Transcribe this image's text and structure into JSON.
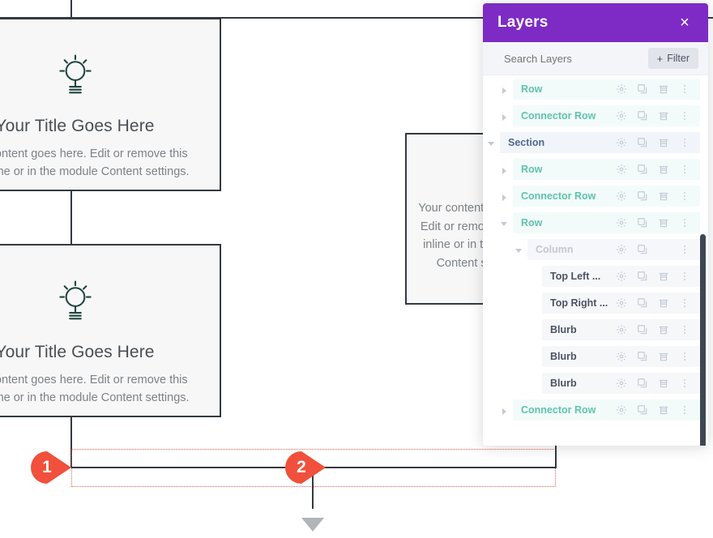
{
  "canvas": {
    "cards": [
      {
        "icon": "lightbulb-icon",
        "title": "Your Title Goes Here",
        "body": "Your content goes here. Edit or remove this text inline or in the module Content settings."
      },
      {
        "icon": "lightbulb-icon",
        "title": "Your Title Goes Here",
        "body": "Your content goes here. Edit or remove this text inline or in the module Content settings."
      }
    ],
    "content_box": {
      "text": "Your content goes here. Edit or remove this text inline or in the module Content settings."
    },
    "markers": [
      {
        "number": "1"
      },
      {
        "number": "2"
      }
    ],
    "selection_color": "#e8614d",
    "line_color": "#333a3f",
    "arrow_color": "#b0b5ba"
  },
  "layers_panel": {
    "title": "Layers",
    "close_label": "×",
    "accent": "#7d2bc4",
    "search": {
      "placeholder": "Search Layers",
      "value": ""
    },
    "filter": {
      "plus": "+",
      "label": "Filter"
    },
    "icons": {
      "settings": "gear-icon",
      "duplicate": "duplicate-icon",
      "delete": "trash-icon",
      "more": "more-vertical-icon"
    },
    "rows": [
      {
        "label": "Row",
        "type": "row",
        "indent": 1,
        "caret": "closed",
        "actions": [
          "settings",
          "duplicate",
          "delete",
          "more"
        ]
      },
      {
        "label": "Connector Row",
        "type": "row",
        "indent": 1,
        "caret": "closed",
        "actions": [
          "settings",
          "duplicate",
          "delete",
          "more"
        ]
      },
      {
        "label": "Section",
        "type": "section",
        "indent": 0,
        "caret": "open",
        "actions": [
          "settings",
          "duplicate",
          "delete",
          "more"
        ]
      },
      {
        "label": "Row",
        "type": "row",
        "indent": 1,
        "caret": "closed",
        "actions": [
          "settings",
          "duplicate",
          "delete",
          "more"
        ]
      },
      {
        "label": "Connector Row",
        "type": "row",
        "indent": 1,
        "caret": "closed",
        "actions": [
          "settings",
          "duplicate",
          "delete",
          "more"
        ]
      },
      {
        "label": "Row",
        "type": "row",
        "indent": 1,
        "caret": "open",
        "actions": [
          "settings",
          "duplicate",
          "delete",
          "more"
        ]
      },
      {
        "label": "Column",
        "type": "column",
        "indent": 2,
        "caret": "open",
        "actions": [
          "settings",
          "duplicate",
          "more"
        ]
      },
      {
        "label": "Top Left ...",
        "type": "module",
        "indent": 3,
        "caret": "none",
        "actions": [
          "settings",
          "duplicate",
          "delete",
          "more"
        ]
      },
      {
        "label": "Top Right ...",
        "type": "module",
        "indent": 3,
        "caret": "none",
        "actions": [
          "settings",
          "duplicate",
          "delete",
          "more"
        ]
      },
      {
        "label": "Blurb",
        "type": "module",
        "indent": 3,
        "caret": "none",
        "actions": [
          "settings",
          "duplicate",
          "delete",
          "more"
        ]
      },
      {
        "label": "Blurb",
        "type": "module",
        "indent": 3,
        "caret": "none",
        "actions": [
          "settings",
          "duplicate",
          "delete",
          "more"
        ]
      },
      {
        "label": "Blurb",
        "type": "module",
        "indent": 3,
        "caret": "none",
        "actions": [
          "settings",
          "duplicate",
          "delete",
          "more"
        ]
      },
      {
        "label": "Connector Row",
        "type": "row",
        "indent": 1,
        "caret": "closed",
        "actions": [
          "settings",
          "duplicate",
          "delete",
          "more"
        ]
      }
    ]
  }
}
